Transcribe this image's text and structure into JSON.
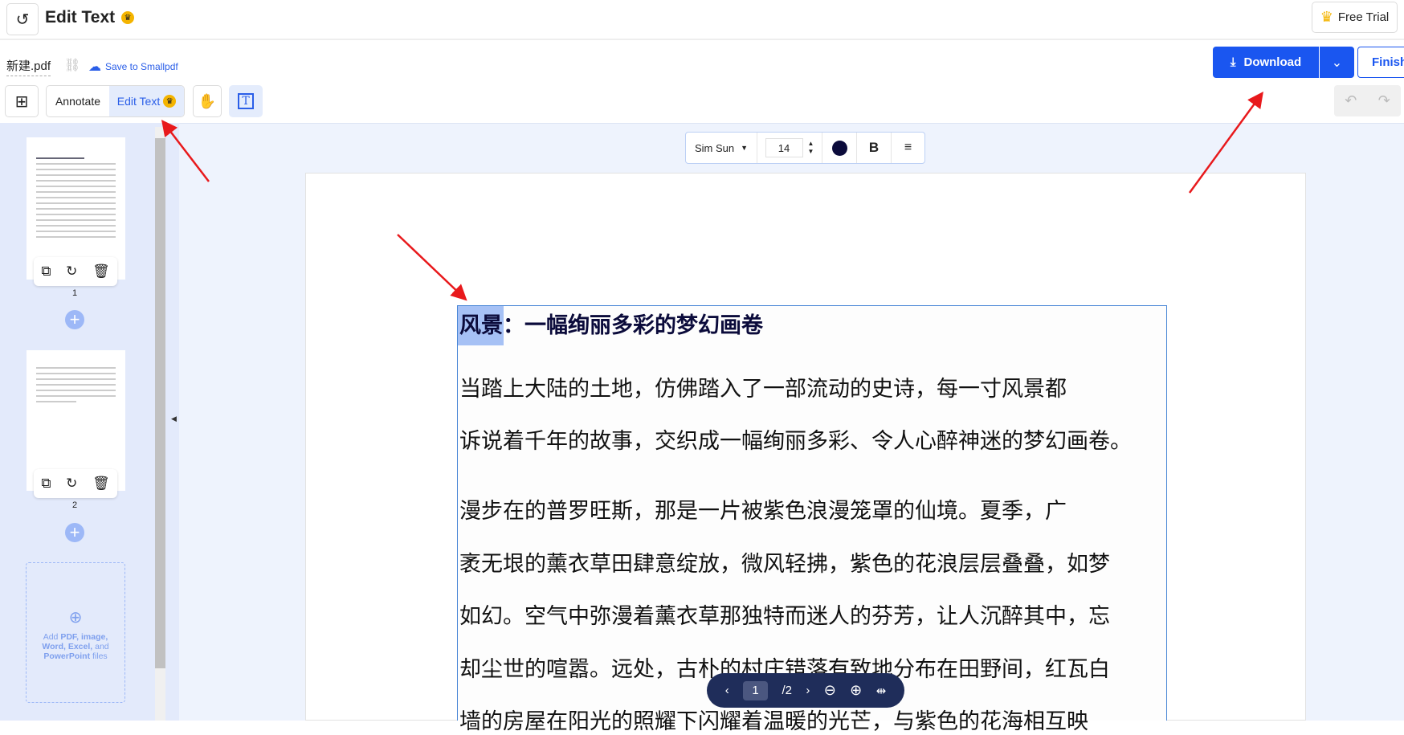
{
  "header": {
    "title": "Edit Text",
    "free_trial": "Free Trial"
  },
  "file": {
    "name": "新建.pdf",
    "save": "Save to Smallpdf"
  },
  "toolbar": {
    "annotate": "Annotate",
    "edit_text": "Edit Text"
  },
  "actions": {
    "download": "Download",
    "finish": "Finish"
  },
  "format": {
    "font": "Sim Sun",
    "size": "14",
    "bold": "B",
    "color": "#0b0b3b"
  },
  "sidebar": {
    "pages": [
      "1",
      "2"
    ],
    "add_files": {
      "pre": "Add ",
      "b1": "PDF, image, Word, Excel,",
      "mid": " and ",
      "b2": "PowerPoint",
      "post": " files"
    }
  },
  "document": {
    "title_selected": "风景",
    "title_rest": "：一幅绚丽多彩的梦幻画卷",
    "lines": [
      "当踏上大陆的土地，仿佛踏入了一部流动的史诗，每一寸风景都",
      "诉说着千年的故事，交织成一幅绚丽多彩、令人心醉神迷的梦幻画卷。",
      "漫步在的普罗旺斯，那是一片被紫色浪漫笼罩的仙境。夏季，广",
      "袤无垠的薰衣草田肆意绽放，微风轻拂，紫色的花浪层层叠叠，如梦",
      "如幻。空气中弥漫着薰衣草那独特而迷人的芬芳，让人沉醉其中，忘",
      "却尘世的喧嚣。远处，古朴的村庄错落有致地分布在田野间，红瓦白",
      "墙的房屋在阳光的照耀下闪耀着温暖的光芒，与紫色的花海相互映"
    ]
  },
  "nav": {
    "page": "1",
    "total": "/2"
  },
  "colors": {
    "accent": "#1a56f0",
    "selection": "#a6c1f5",
    "nav_bg": "#1f2d5a"
  }
}
